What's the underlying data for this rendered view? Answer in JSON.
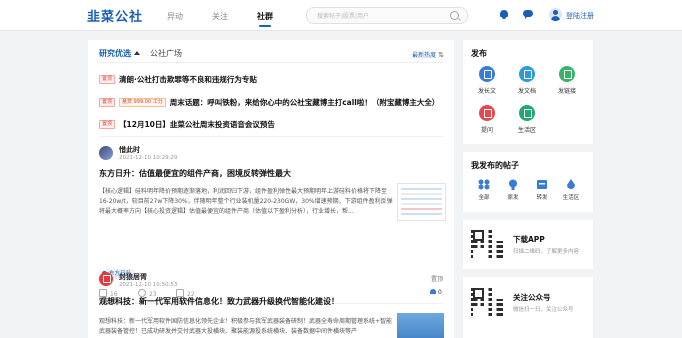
{
  "header": {
    "logo": "韭菜公社",
    "nav": [
      "异动",
      "关注",
      "社群"
    ],
    "active_nav": "社群",
    "search_placeholder": "搜索帖子|股票|用户",
    "login_label": "登陆注册"
  },
  "feed": {
    "tabs": [
      "研究优选",
      "公社广场"
    ],
    "sort_label": "最新热度",
    "pinned": [
      {
        "tags": [
          "置顶"
        ],
        "title": "清朗·公社打击欺罪等不良和违规行为专贴"
      },
      {
        "tags": [
          "置顶",
          "悬赏 999.00 工分"
        ],
        "title": "周末话题：呼叫铁粉，来给你心中的公社宝藏博主打call啦！（附宝藏博主大全）"
      },
      {
        "tags": [
          "置顶"
        ],
        "title": "【12月10日】韭菜公社周末投资语音会议预告"
      }
    ],
    "posts": [
      {
        "author": "惜此时",
        "time": "2021-12-10 10:29:29",
        "title": "东方日升：估值最便宜的组件产商，困境反转弹性最大",
        "excerpt": "【核心逻辑】硅料明年降价预期逐渐落地，利润回归下游，组件盈利弹性最大预期明年上游硅料价格将下降至16-20w/t，较目前27w下降30%，伴随明年整个行业装机量220-230GW，30%增速预期，下游组件盈利反弹将最大概率方向【核心投资逻辑】估值最便宜的组件产商（估值以下盈利分析），行业增长，帮...",
        "topic": "东方日升",
        "likes": "16",
        "comments": "23",
        "shares": "22",
        "favorites": "0"
      },
      {
        "author": "封狼居胥",
        "time": "2021-12-10 10:50:53",
        "follow_label": "置顶",
        "title": "观想科技：新一代军用软件信息化！致力武器升级换代智能化建设！",
        "excerpt": "观想科技：新一代军用软件国防信息化领先企业！积极参与我军武器装备研制！武器全寿命周期管理系统+智能武器装备管控！已成功研发并交付武器大投横块、聚装能源投系统横块、装备数据中间件横块等产"
      }
    ]
  },
  "sidebar": {
    "publish_title": "发布",
    "publish_items": [
      {
        "label": "发长文",
        "color": "#3a7bd5"
      },
      {
        "label": "发文档",
        "color": "#2f9ad8"
      },
      {
        "label": "发链接",
        "color": "#3bb26a"
      },
      {
        "label": "提问",
        "color": "#e5484d"
      },
      {
        "label": "生活区",
        "color": "#21a870"
      }
    ],
    "my_title": "我发布的帖子",
    "my_items": [
      "全部",
      "原发",
      "转发",
      "生活区"
    ],
    "app_title": "下载APP",
    "app_sub": "扫描二维码，了解更多内容",
    "wx_title": "关注公众号",
    "wx_sub": "微信扫一扫，关注公众号"
  }
}
